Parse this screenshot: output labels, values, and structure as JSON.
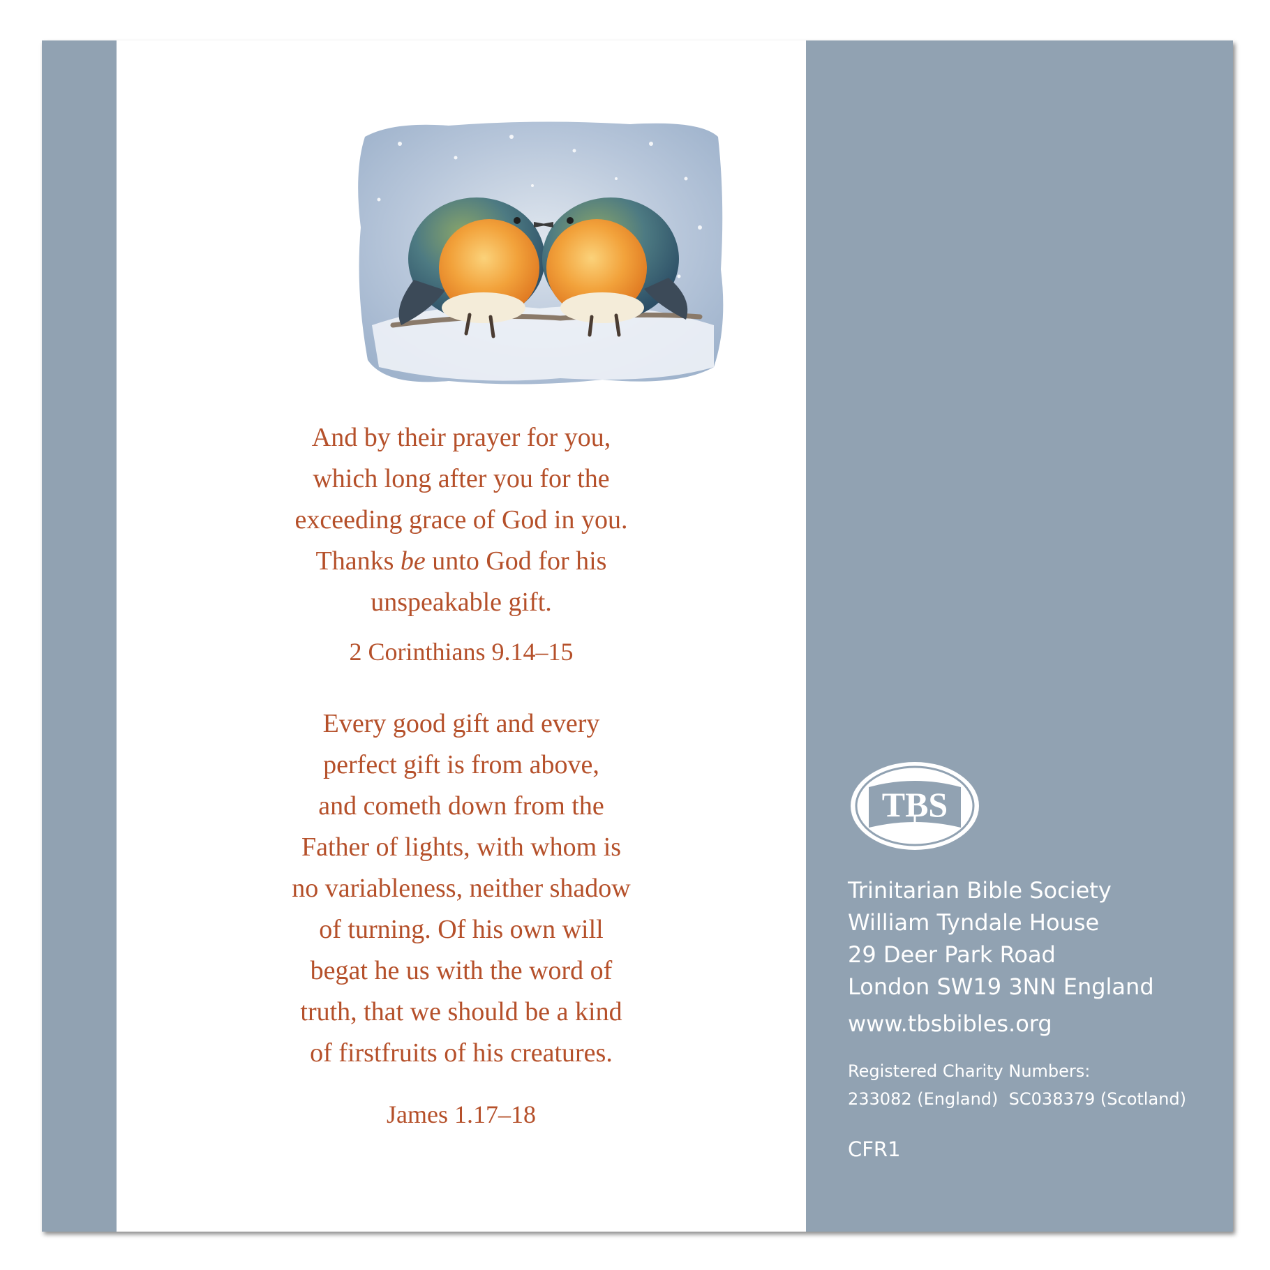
{
  "colors": {
    "card_blue": "#91a2b2",
    "verse_text": "#b5502a",
    "white": "#ffffff"
  },
  "illustration": {
    "icon": "two-robins-watercolor-illustration"
  },
  "verse1": {
    "lines": [
      "And by their prayer for you,",
      "which long after you for the",
      "exceeding grace of God in you.",
      "Thanks",
      "be",
      "unto God for his",
      "unspeakable gift."
    ],
    "reference": "2 Corinthians 9.14–15"
  },
  "verse2": {
    "lines": [
      "Every good gift and every",
      "perfect gift is from above,",
      "and cometh down from the",
      "Father of lights, with whom is",
      "no variableness, neither shadow",
      "of turning. Of his own will",
      "begat he us with the word of",
      "truth, that we should be a kind",
      "of firstfruits of his creatures."
    ],
    "reference": "James 1.17–18"
  },
  "publisher": {
    "logo_text": "TBS",
    "address": [
      "Trinitarian Bible Society",
      "William Tyndale House",
      "29 Deer Park Road",
      "London SW19 3NN England"
    ],
    "website": "www.tbsbibles.org",
    "charity_label": "Registered Charity Numbers:",
    "charity_numbers": "233082 (England)  SC038379 (Scotland)",
    "code": "CFR1"
  }
}
